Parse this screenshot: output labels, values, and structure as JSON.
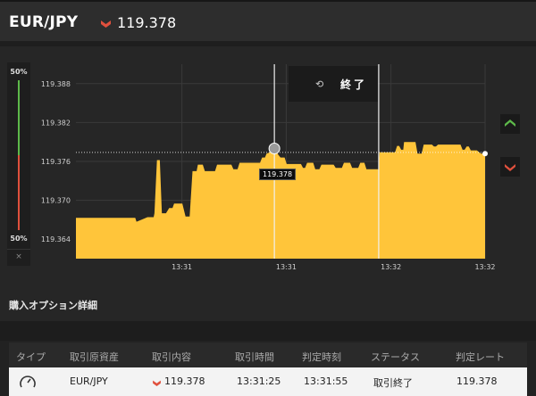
{
  "header": {
    "pair": "EUR/JPY",
    "price": "119.378",
    "direction": "down",
    "down_color": "#e0503d",
    "up_color": "#5db94a"
  },
  "gauge": {
    "top_pct": "50%",
    "bottom_pct": "50%",
    "close_label": "×"
  },
  "chart": {
    "end_label": "終了",
    "marker_price": "119.378",
    "call_icon": "chevron-up-icon",
    "put_icon": "chevron-down-icon",
    "fill_color": "#ffc53a"
  },
  "chart_data": {
    "type": "area",
    "ylim": [
      119.361,
      119.391
    ],
    "yticks": [
      "119.388",
      "119.382",
      "119.376",
      "119.370",
      "119.364"
    ],
    "ytick_values": [
      119.388,
      119.382,
      119.376,
      119.37,
      119.364
    ],
    "xtick_labels": [
      "13:31",
      "13:31",
      "13:32",
      "13:32"
    ],
    "xtick_positions": [
      0.259,
      0.514,
      0.77,
      1.0
    ],
    "entry_t": 0.485,
    "entry_price": 119.378,
    "expiry_t": 0.74,
    "strike_price": 119.3774,
    "series": [
      {
        "values": [
          [
            0.0,
            119.3673
          ],
          [
            0.145,
            119.3673
          ],
          [
            0.148,
            119.3667
          ],
          [
            0.16,
            119.367
          ],
          [
            0.175,
            119.3674
          ],
          [
            0.19,
            119.3674
          ],
          [
            0.192,
            119.368
          ],
          [
            0.198,
            119.3762
          ],
          [
            0.205,
            119.3762
          ],
          [
            0.21,
            119.368
          ],
          [
            0.22,
            119.368
          ],
          [
            0.228,
            119.3688
          ],
          [
            0.236,
            119.3688
          ],
          [
            0.24,
            119.3695
          ],
          [
            0.26,
            119.3695
          ],
          [
            0.268,
            119.3675
          ],
          [
            0.278,
            119.3675
          ],
          [
            0.285,
            119.3745
          ],
          [
            0.295,
            119.3745
          ],
          [
            0.298,
            119.3755
          ],
          [
            0.31,
            119.3755
          ],
          [
            0.315,
            119.3745
          ],
          [
            0.34,
            119.3745
          ],
          [
            0.345,
            119.3755
          ],
          [
            0.38,
            119.3755
          ],
          [
            0.385,
            119.3748
          ],
          [
            0.395,
            119.3748
          ],
          [
            0.4,
            119.3758
          ],
          [
            0.45,
            119.3758
          ],
          [
            0.455,
            119.3766
          ],
          [
            0.462,
            119.3766
          ],
          [
            0.466,
            119.3772
          ],
          [
            0.478,
            119.3775
          ],
          [
            0.485,
            119.378
          ],
          [
            0.495,
            119.377
          ],
          [
            0.5,
            119.3766
          ],
          [
            0.51,
            119.3766
          ],
          [
            0.515,
            119.3756
          ],
          [
            0.55,
            119.3756
          ],
          [
            0.555,
            119.375
          ],
          [
            0.56,
            119.375
          ],
          [
            0.565,
            119.3758
          ],
          [
            0.58,
            119.3758
          ],
          [
            0.585,
            119.3748
          ],
          [
            0.595,
            119.3748
          ],
          [
            0.6,
            119.3755
          ],
          [
            0.63,
            119.3755
          ],
          [
            0.635,
            119.375
          ],
          [
            0.65,
            119.375
          ],
          [
            0.655,
            119.3758
          ],
          [
            0.67,
            119.3758
          ],
          [
            0.675,
            119.375
          ],
          [
            0.69,
            119.375
          ],
          [
            0.695,
            119.3758
          ],
          [
            0.705,
            119.3758
          ],
          [
            0.71,
            119.3748
          ],
          [
            0.74,
            119.3748
          ],
          [
            0.742,
            119.3774
          ],
          [
            0.78,
            119.3774
          ],
          [
            0.785,
            119.3784
          ],
          [
            0.79,
            119.3784
          ],
          [
            0.795,
            119.3778
          ],
          [
            0.8,
            119.3778
          ],
          [
            0.802,
            119.379
          ],
          [
            0.83,
            119.379
          ],
          [
            0.835,
            119.3772
          ],
          [
            0.845,
            119.3772
          ],
          [
            0.85,
            119.3786
          ],
          [
            0.87,
            119.3786
          ],
          [
            0.875,
            119.3783
          ],
          [
            0.88,
            119.3783
          ],
          [
            0.885,
            119.3786
          ],
          [
            0.94,
            119.3786
          ],
          [
            0.945,
            119.3778
          ],
          [
            0.95,
            119.3778
          ],
          [
            0.955,
            119.3783
          ],
          [
            0.96,
            119.3783
          ],
          [
            0.965,
            119.3777
          ],
          [
            0.98,
            119.3777
          ],
          [
            0.99,
            119.3772
          ],
          [
            1.0,
            119.3772
          ]
        ]
      }
    ]
  },
  "section": {
    "title": "購入オプション詳細"
  },
  "table": {
    "headers": [
      "タイプ",
      "取引原資産",
      "取引内容",
      "取引時間",
      "判定時刻",
      "ステータス",
      "判定レート"
    ],
    "row": {
      "type_icon": "clock-icon",
      "asset": "EUR/JPY",
      "content": "119.378",
      "trade_time": "13:31:25",
      "judge_time": "13:31:55",
      "status": "取引終了",
      "rate": "119.378"
    }
  }
}
